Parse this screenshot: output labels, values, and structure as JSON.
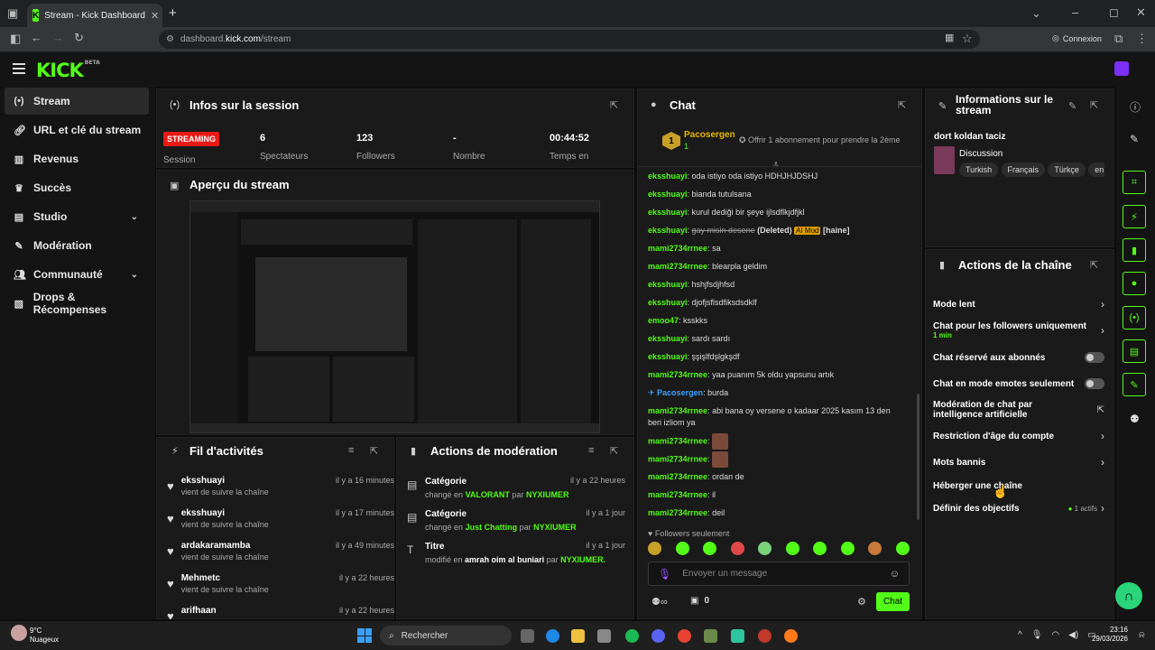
{
  "browser": {
    "tab_title": "Stream - Kick Dashboard",
    "url_prefix": "dashboard.",
    "url_domain": "kick.com",
    "url_path": "/stream",
    "profile_label": "Connexion",
    "new_tab": "+"
  },
  "app": {
    "logo": "KICK",
    "logo_badge": "BETA"
  },
  "sidebar": {
    "items": [
      {
        "label": "Stream"
      },
      {
        "label": "URL et clé du stream"
      },
      {
        "label": "Revenus"
      },
      {
        "label": "Succès"
      },
      {
        "label": "Studio"
      },
      {
        "label": "Modération"
      },
      {
        "label": "Communauté"
      },
      {
        "label": "Drops & Récompenses"
      }
    ]
  },
  "session": {
    "title": "Infos sur la session",
    "status": "STREAMING",
    "status_label": "Session",
    "viewers": "6",
    "viewers_label": "Spectateurs",
    "followers": "123",
    "followers_label": "Followers",
    "count": "-",
    "count_label": "Nombre",
    "time": "00:44:52",
    "time_label": "Temps en"
  },
  "preview": {
    "title": "Aperçu du stream"
  },
  "feed": {
    "title": "Fil d'activités",
    "items": [
      {
        "user": "eksshuayi",
        "text": "vient de suivre la chaîne",
        "time": "il y a 16 minutes"
      },
      {
        "user": "eksshuayi",
        "text": "vient de suivre la chaîne",
        "time": "il y a 17 minutes"
      },
      {
        "user": "ardakaramamba",
        "text": "vient de suivre la chaîne",
        "time": "il y a 49 minutes"
      },
      {
        "user": "Mehmetc",
        "text": "vient de suivre la chaîne",
        "time": "il y a 22 heures"
      },
      {
        "user": "arifhaan",
        "text": "",
        "time": "il y a 22 heures"
      }
    ]
  },
  "modactions": {
    "title": "Actions de modération",
    "items": [
      {
        "title": "Catégorie",
        "pre": "changé en",
        "value": "VALORANT",
        "by": "par",
        "mod": "NYXIUMER",
        "time": "il y a 22 heures"
      },
      {
        "title": "Catégorie",
        "pre": "changé en",
        "value": "Just Chatting",
        "by": "par",
        "mod": "NYXIUMER",
        "time": "il y a 1 jour"
      },
      {
        "title": "Titre",
        "pre": "modifié en",
        "value": "amrah oim al buniari",
        "by": "par",
        "mod": "NYXIUMER.",
        "time": "il y a 1 jour"
      }
    ]
  },
  "chat": {
    "title": "Chat",
    "pinned_rank": "1",
    "pinned_user": "Pacosergen",
    "pinned_count": "1",
    "pinned_msg": "Offrir 1 abonnement pour prendre la 2ème",
    "messages": [
      {
        "user": "eksshuayi",
        "text": "oda istiyo oda istiyo HDHJHJDSHJ"
      },
      {
        "user": "eksshuayi",
        "text": "bianda tutulsana"
      },
      {
        "user": "eksshuayi",
        "text": "kurul dediği bir şeye ijlsdflkjdfjkl"
      },
      {
        "user": "eksshuayi",
        "text": "gay misin desene",
        "deleted": "(Deleted)",
        "mod": "AI Mod",
        "reason": "[haine]"
      },
      {
        "user": "mami2734rrnee",
        "text": "sa"
      },
      {
        "user": "mami2734rrnee",
        "text": "blearpla geldim"
      },
      {
        "user": "eksshuayi",
        "text": "hshjfsdjhfsd"
      },
      {
        "user": "eksshuayi",
        "text": "djofjsflsdfiksdsdklf"
      },
      {
        "user": "emoo47",
        "text": "ksskks"
      },
      {
        "user": "eksshuayi",
        "text": "sardı sardı"
      },
      {
        "user": "eksshuayi",
        "text": "şşişlfdşlgkşdf"
      },
      {
        "user": "mami2734rrnee",
        "text": "yaa puanım 5k oldu yapsunu artık"
      },
      {
        "user": "Pacosergen",
        "text": "burda"
      },
      {
        "user": "mami2734rrnee",
        "text": "abi bana oy versene o kadaar 2025 kasım 13 den",
        "text2": "beri izliom ya"
      },
      {
        "user": "mami2734rrnee",
        "text": ""
      },
      {
        "user": "mami2734rrnee",
        "text": ""
      },
      {
        "user": "mami2734rrnee",
        "text": "ordan de"
      },
      {
        "user": "mami2734rrnee",
        "text": "il"
      },
      {
        "user": "mami2734rrnee",
        "text": "deil"
      }
    ],
    "followers_only": "Followers seulement",
    "placeholder": "Envoyer un message",
    "points": "0",
    "send": "Chat"
  },
  "streaminfo": {
    "title1": "Informations sur le",
    "title2": "stream",
    "stream_title": "dort koldan taciz",
    "category": "Discussion",
    "tags": [
      "Turkish",
      "Français",
      "Türkçe",
      "en"
    ]
  },
  "channelactions": {
    "title": "Actions de la chaîne",
    "rows": [
      {
        "label": "Mode lent"
      },
      {
        "label": "Chat pour les followers uniquement",
        "sub": "1 min"
      },
      {
        "label": "Chat réservé aux abonnés"
      },
      {
        "label": "Chat en mode emotes seulement"
      },
      {
        "label": "Modération de chat par intelligence artificielle"
      },
      {
        "label": "Restriction d'âge du compte"
      },
      {
        "label": "Mots bannis"
      },
      {
        "label": "Héberger une chaîne"
      },
      {
        "label": "Définir des objectifs",
        "sub": "1 actifs"
      }
    ]
  },
  "taskbar": {
    "weather_temp": "9°C",
    "weather_text": "Nuageux",
    "search": "Rechercher",
    "time": "23:16",
    "date": "29/03/2026"
  },
  "colors": {
    "accent": "#53fc18",
    "live": "#e91916"
  }
}
